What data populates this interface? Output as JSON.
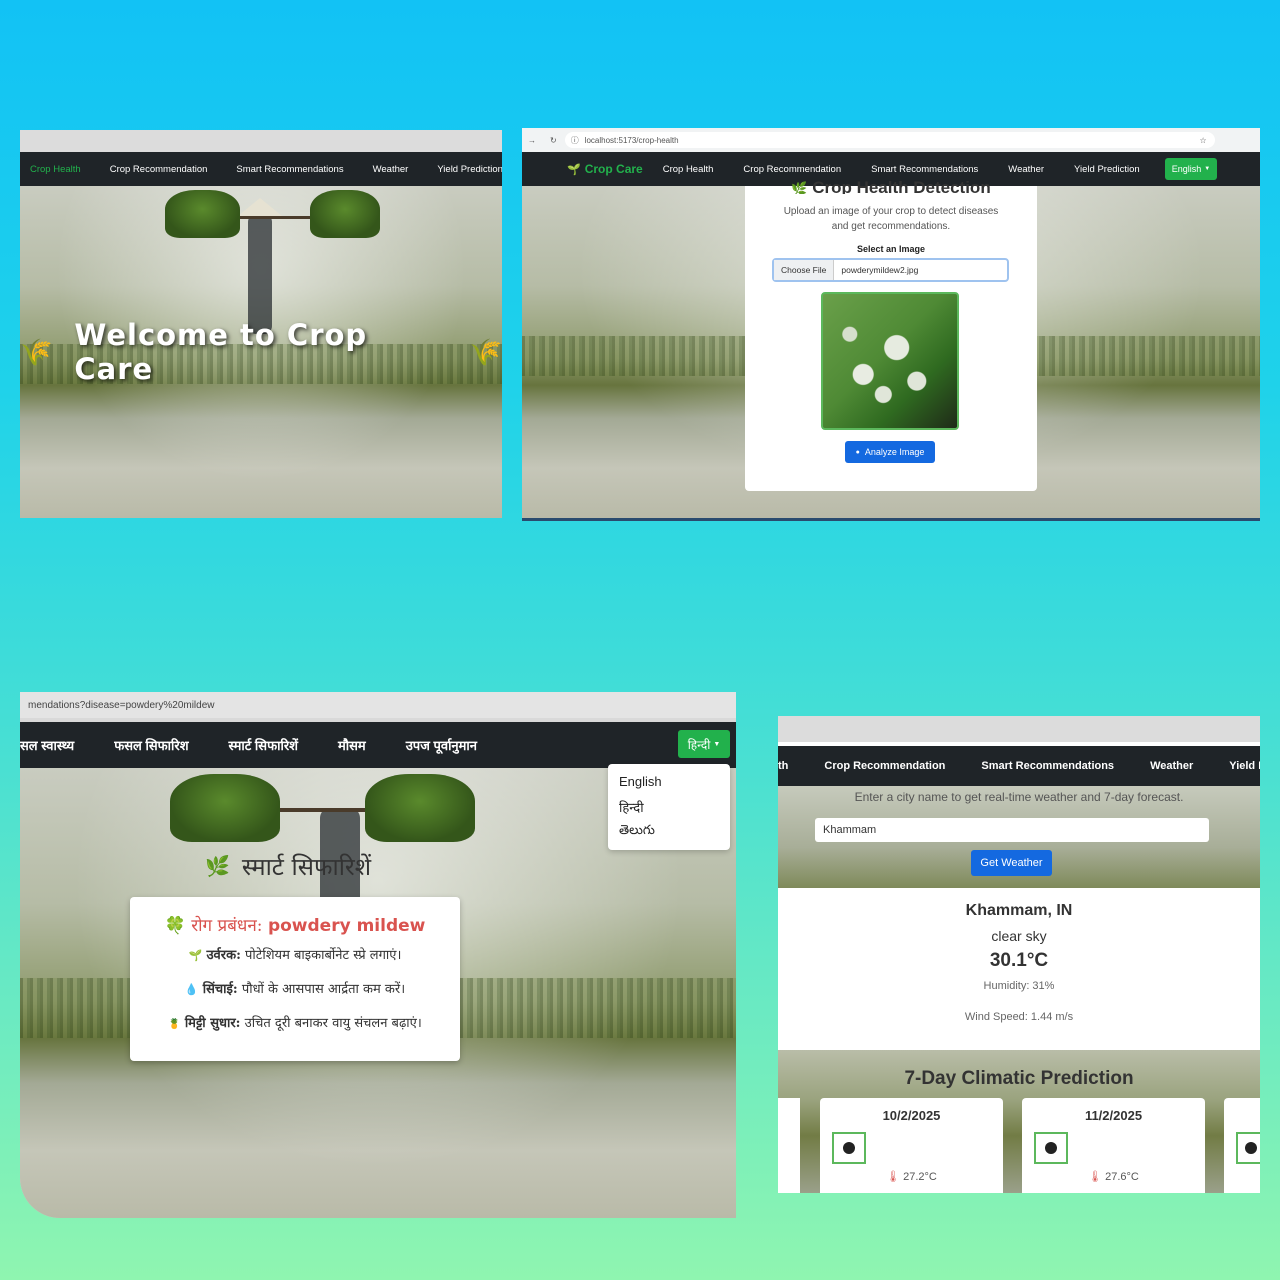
{
  "panel1": {
    "nav_items": [
      "Crop Health",
      "Crop Recommendation",
      "Smart Recommendations",
      "Weather",
      "Yield Prediction"
    ],
    "hero_title": "Welcome to Crop Care",
    "emoji": "🌾"
  },
  "panel2": {
    "url": "localhost:5173/crop-health",
    "brand": "Crop Care",
    "brand_icon": "🌱",
    "nav_items": [
      "Crop Health",
      "Crop Recommendation",
      "Smart Recommendations",
      "Weather",
      "Yield Prediction"
    ],
    "language_button": "English",
    "page_title": "Crop Health Detection",
    "subtitle": "Upload an image of your crop to detect diseases and get recommendations.",
    "select_label": "Select an Image",
    "choose_file_label": "Choose File",
    "file_name": "powderymildew2.jpg",
    "analyze_button": "Analyze Image"
  },
  "panel3": {
    "url": "mendations?disease=powdery%20mildew",
    "nav_items": [
      "सल स्वास्थ्य",
      "फसल सिफारिश",
      "स्मार्ट सिफारिशें",
      "मौसम",
      "उपज पूर्वानुमान"
    ],
    "language_button": "हिन्दी",
    "language_options": [
      "English",
      "हिन्दी",
      "తెలుగు"
    ],
    "page_title": "स्मार्ट सिफारिशें",
    "disease_label": "रोग प्रबंधन:",
    "disease_value": "powdery mildew",
    "recommendations": [
      {
        "icon": "🌱",
        "label": "उर्वरक:",
        "text": "पोटेशियम बाइकार्बोनेट स्प्रे लगाएं।"
      },
      {
        "icon": "💧",
        "label": "सिंचाई:",
        "text": "पौधों के आसपास आर्द्रता कम करें।"
      },
      {
        "icon": "🍍",
        "label": "मिट्टी सुधार:",
        "text": "उचित दूरी बनाकर वायु संचलन बढ़ाएं।"
      }
    ]
  },
  "panel4": {
    "nav_items": [
      "th",
      "Crop Recommendation",
      "Smart Recommendations",
      "Weather",
      "Yield Pre"
    ],
    "instruction": "Enter a city name to get real-time weather and 7-day forecast.",
    "city_value": "Khammam",
    "get_weather_button": "Get Weather",
    "location": "Khammam, IN",
    "condition": "clear sky",
    "temperature": "30.1°C",
    "humidity": "Humidity: 31%",
    "wind": "Wind Speed: 1.44 m/s",
    "forecast_title": "7-Day Climatic Prediction",
    "forecast": [
      {
        "date": "10/2/2025",
        "temp": "27.2°C"
      },
      {
        "date": "11/2/2025",
        "temp": "27.6°C"
      }
    ]
  }
}
